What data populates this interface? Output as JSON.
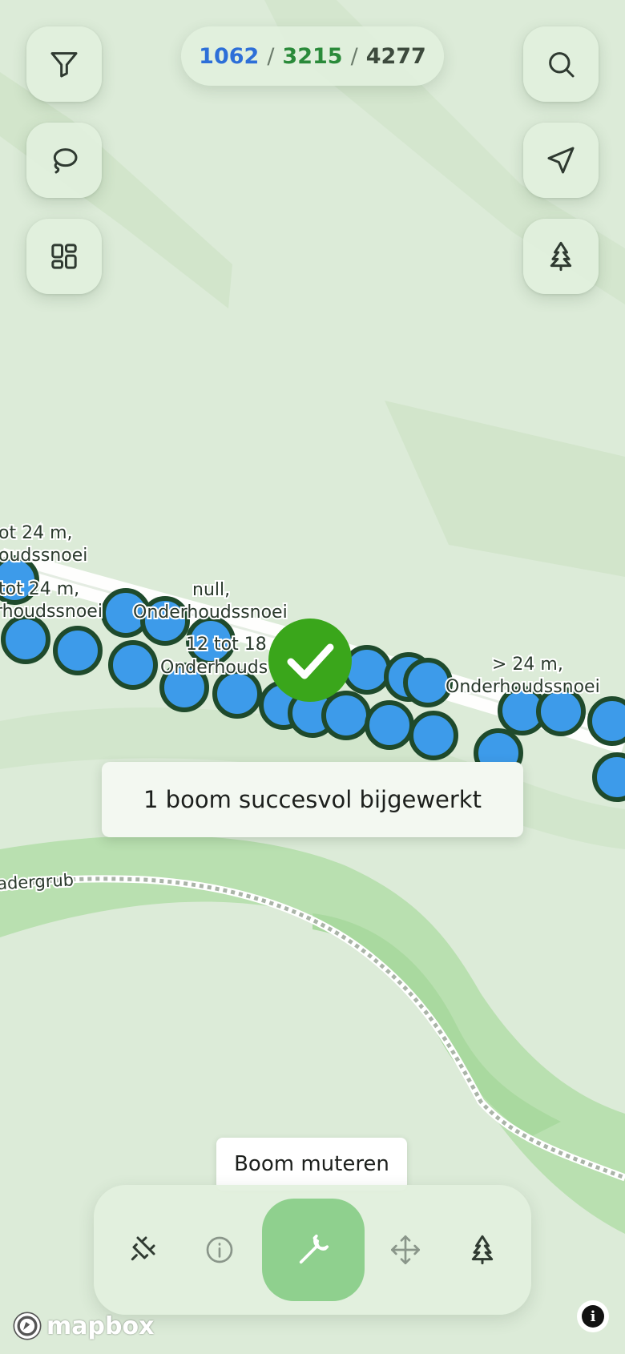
{
  "counter": {
    "blue": "1062",
    "green": "3215",
    "total": "4277",
    "separator": "/"
  },
  "map": {
    "tree_labels": [
      {
        "line1": "ot 24 m,",
        "line2": "oudssnoei"
      },
      {
        "line1": "tot 24 m,",
        "line2": "rhoudssnoei"
      },
      {
        "line1": "null,",
        "line2": "Onderhoudssnoei"
      },
      {
        "line1": "12 tot 18 m",
        "line2": "Onderhouds"
      },
      {
        "line1": "> 24 m,",
        "line2": "Onderhoudssnoei"
      }
    ],
    "road_label": "adergrub"
  },
  "top_left_buttons": [
    {
      "icon": "filter-icon"
    },
    {
      "icon": "lasso-icon"
    },
    {
      "icon": "layers-grid-icon"
    }
  ],
  "top_right_buttons": [
    {
      "icon": "search-icon"
    },
    {
      "icon": "navigation-arrow-icon"
    },
    {
      "icon": "tree-icon"
    }
  ],
  "toast": {
    "message": "1 boom succesvol bijgewerkt",
    "status": "success"
  },
  "tooltip": {
    "text": "Boom muteren"
  },
  "toolbar": {
    "items": [
      {
        "icon": "delete-pin-icon"
      },
      {
        "icon": "info-icon"
      },
      {
        "icon": "wrench-icon",
        "active": true
      },
      {
        "icon": "move-icon"
      },
      {
        "icon": "tree-icon"
      }
    ]
  },
  "attribution": {
    "logo_text": "mapbox"
  },
  "colors": {
    "tree_point": "#3d9bea",
    "tree_point_border": "#1f4a2c",
    "success": "#3aa61b",
    "active_tool": "#8fd08e",
    "counter_blue": "#2d6fd8",
    "counter_green": "#2a8a3a"
  }
}
